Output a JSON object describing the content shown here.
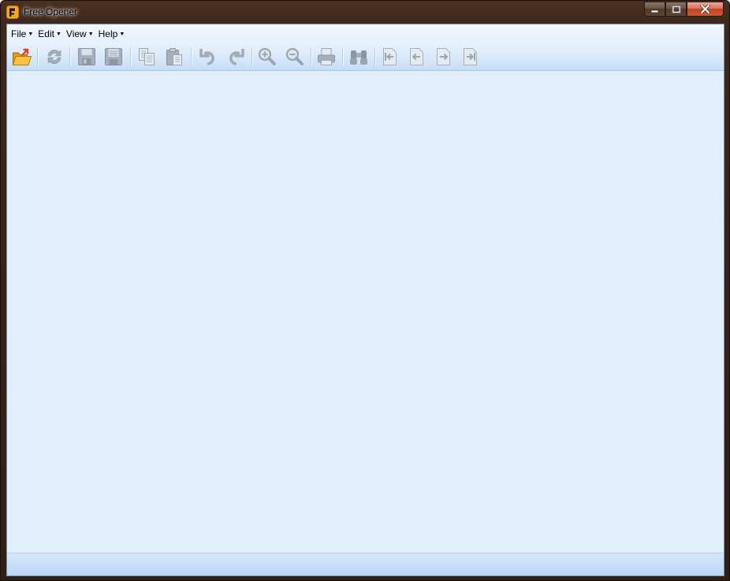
{
  "window": {
    "title": "Free Opener",
    "controls": {
      "minimize": "minimize",
      "maximize": "maximize",
      "close": "close"
    }
  },
  "menu": {
    "items": [
      {
        "label": "File"
      },
      {
        "label": "Edit"
      },
      {
        "label": "View"
      },
      {
        "label": "Help"
      }
    ]
  },
  "toolbar": {
    "buttons": [
      {
        "icon": "open-folder-icon",
        "enabled": true
      },
      {
        "icon": "refresh-icon",
        "enabled": false
      },
      {
        "icon": "save-icon",
        "enabled": false
      },
      {
        "icon": "save-as-icon",
        "enabled": false
      },
      {
        "icon": "copy-icon",
        "enabled": false
      },
      {
        "icon": "paste-icon",
        "enabled": false
      },
      {
        "icon": "undo-icon",
        "enabled": false
      },
      {
        "icon": "redo-icon",
        "enabled": false
      },
      {
        "icon": "zoom-in-icon",
        "enabled": false
      },
      {
        "icon": "zoom-out-icon",
        "enabled": false
      },
      {
        "icon": "print-icon",
        "enabled": false
      },
      {
        "icon": "find-binoculars-icon",
        "enabled": false
      },
      {
        "icon": "first-page-icon",
        "enabled": false
      },
      {
        "icon": "previous-page-icon",
        "enabled": false
      },
      {
        "icon": "next-page-icon",
        "enabled": false
      },
      {
        "icon": "last-page-icon",
        "enabled": false
      }
    ]
  },
  "colors": {
    "disabled_icon": "#9aa6b4",
    "folder": "#f2b733",
    "arrow_accent": "#e0462b",
    "accent_orange": "#f5a623"
  }
}
